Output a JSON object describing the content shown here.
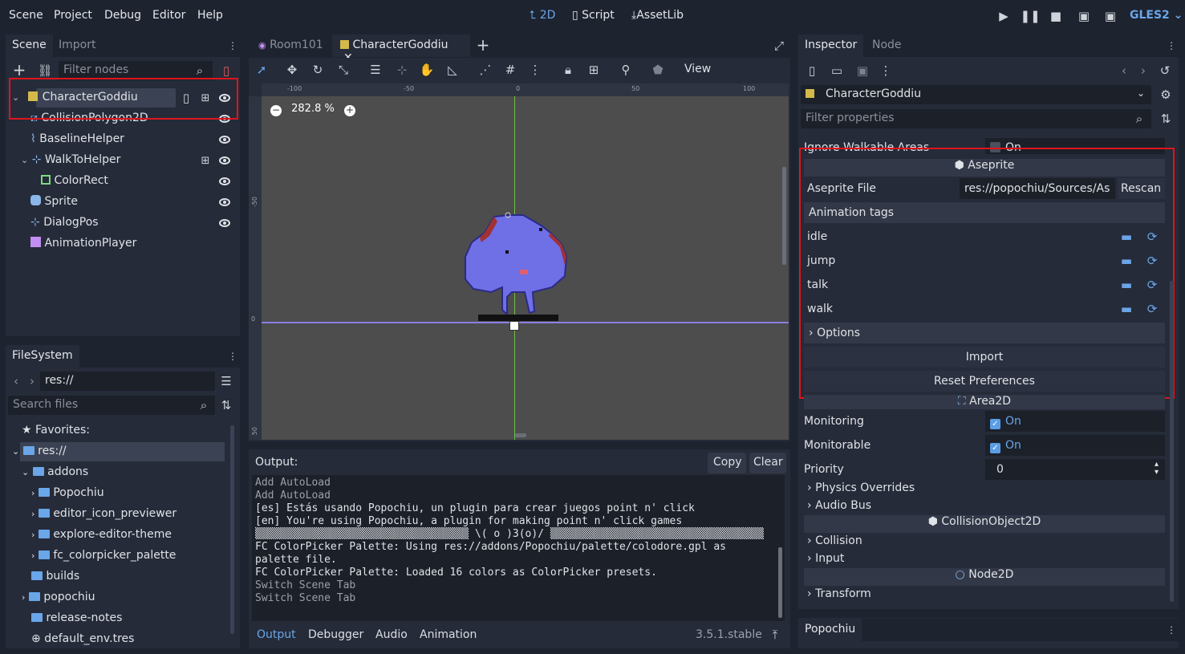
{
  "menu": {
    "scene": "Scene",
    "project": "Project",
    "debug": "Debug",
    "editor": "Editor",
    "help": "Help"
  },
  "workspaces": {
    "twod": "2D",
    "script": "Script",
    "assetlib": "AssetLib"
  },
  "renderer": "GLES2",
  "scene_dock": {
    "tabs": [
      "Scene",
      "Import"
    ],
    "filter_placeholder": "Filter nodes",
    "nodes": [
      {
        "label": "CharacterGoddiu",
        "icon": "character-icon"
      },
      {
        "label": "CollisionPolygon2D",
        "icon": "collision-polygon-icon"
      },
      {
        "label": "BaselineHelper",
        "icon": "line-icon"
      },
      {
        "label": "WalkToHelper",
        "icon": "position-icon"
      },
      {
        "label": "ColorRect",
        "icon": "color-rect-icon"
      },
      {
        "label": "Sprite",
        "icon": "sprite-icon"
      },
      {
        "label": "DialogPos",
        "icon": "position-icon"
      },
      {
        "label": "AnimationPlayer",
        "icon": "animation-player-icon"
      }
    ]
  },
  "filesystem": {
    "title": "FileSystem",
    "path": "res://",
    "search_placeholder": "Search files",
    "favorites": "Favorites:",
    "items": [
      "res://",
      "addons",
      "Popochiu",
      "editor_icon_previewer",
      "explore-editor-theme",
      "fc_colorpicker_palette",
      "builds",
      "popochiu",
      "release-notes",
      "default_env.tres"
    ]
  },
  "editor_tabs": [
    "Room101",
    "CharacterGoddiu"
  ],
  "viewport": {
    "zoom": "282.8 %",
    "view_menu": "View",
    "ruler_top": [
      "-100",
      "-50",
      "0",
      "50",
      "100"
    ],
    "ruler_left": [
      "-50",
      "0",
      "50"
    ]
  },
  "output": {
    "title": "Output:",
    "copy": "Copy",
    "clear": "Clear",
    "lines": [
      {
        "text": "Add AutoLoad",
        "dim": true
      },
      {
        "text": "Add AutoLoad",
        "dim": true
      },
      {
        "text": "[es] Estás usando Popochiu, un plugin para crear juegos point n' click",
        "dim": false
      },
      {
        "text": "[en] You're using Popochiu, a plugin for making point n' click games",
        "dim": false
      },
      {
        "text": "▒▒▒▒▒▒▒▒▒▒▒▒▒▒▒▒▒▒▒▒▒▒▒▒▒▒▒▒▒▒▒▒▒▒ \\( o )3(o)/ ▒▒▒▒▒▒▒▒▒▒▒▒▒▒▒▒▒▒▒▒▒▒▒▒▒▒▒▒▒▒▒▒▒▒",
        "dim": false
      },
      {
        "text": "FC ColorPicker Palette: Using res://addons/Popochiu/palette/colodore.gpl as",
        "dim": false
      },
      {
        "text": "palette file.",
        "dim": false
      },
      {
        "text": "FC ColorPicker Palette: Loaded 16 colors as ColorPicker presets.",
        "dim": false
      },
      {
        "text": "Switch Scene Tab",
        "dim": true
      },
      {
        "text": "Switch Scene Tab",
        "dim": true
      }
    ],
    "bottom_tabs": [
      "Output",
      "Debugger",
      "Audio",
      "Animation"
    ],
    "version": "3.5.1.stable"
  },
  "inspector": {
    "tabs": [
      "Inspector",
      "Node"
    ],
    "node_name": "CharacterGoddiu",
    "filter_placeholder": "Filter properties",
    "ignore_walkable": "Ignore Walkable Areas",
    "ignore_value": "On",
    "aseprite_header": "Aseprite",
    "aseprite_file_label": "Aseprite File",
    "aseprite_file_value": "res://popochiu/Sources/As",
    "rescan": "Rescan",
    "animation_tags": "Animation tags",
    "tags": [
      "idle",
      "jump",
      "talk",
      "walk"
    ],
    "options": "Options",
    "import": "Import",
    "reset": "Reset Preferences",
    "area2d": "Area2D",
    "monitoring": "Monitoring",
    "monitoring_value": "On",
    "monitorable": "Monitorable",
    "monitorable_value": "On",
    "priority": "Priority",
    "priority_value": "0",
    "physics_overrides": "Physics Overrides",
    "audio_bus": "Audio Bus",
    "collision_object": "CollisionObject2D",
    "collision": "Collision",
    "input": "Input",
    "node2d": "Node2D",
    "transform": "Transform"
  },
  "popochiu_dock": "Popochiu",
  "colors": {
    "accent": "#5a9ee6",
    "highlight": "#e0141c",
    "panel": "#252b39",
    "bg": "#1e2330"
  }
}
